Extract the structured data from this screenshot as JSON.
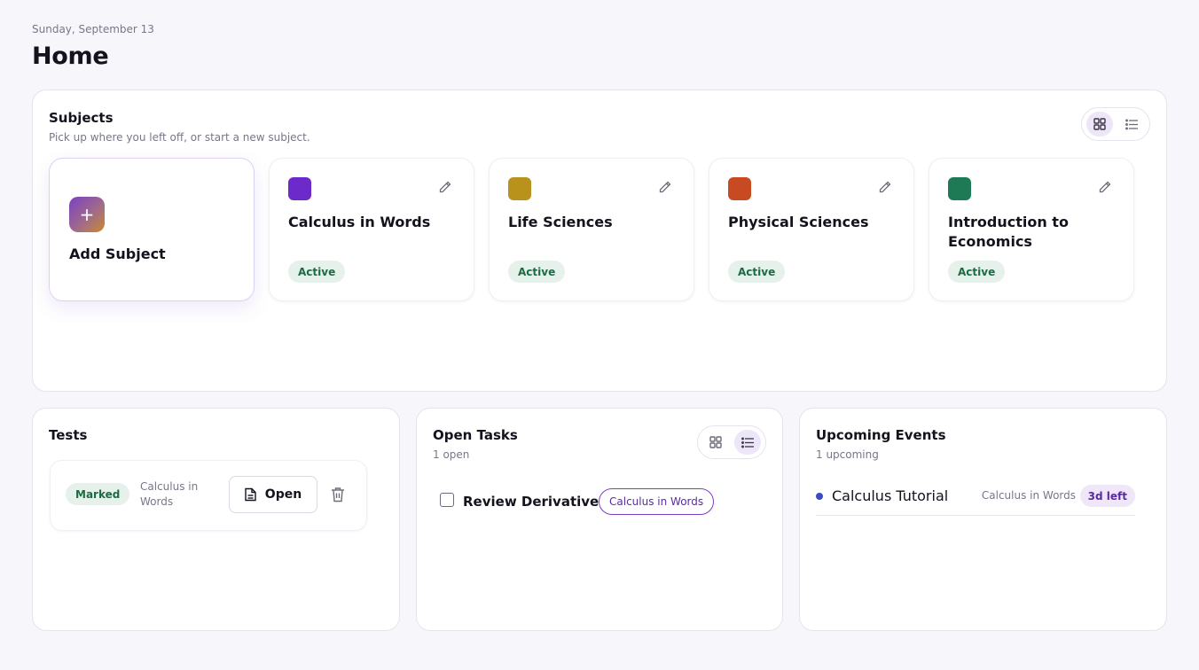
{
  "header": {
    "date": "Sunday, September 13",
    "title": "Home"
  },
  "subjects": {
    "title": "Subjects",
    "subtitle": "Pick up where you left off, or start a new subject.",
    "view": "grid",
    "add_label": "Add Subject",
    "items": [
      {
        "name": "Calculus in Words",
        "status": "Active",
        "color": "#6b2ac9"
      },
      {
        "name": "Life Sciences",
        "status": "Active",
        "color": "#b8921a"
      },
      {
        "name": "Physical Sciences",
        "status": "Active",
        "color": "#c84a22"
      },
      {
        "name": "Introduction to Economics",
        "status": "Active",
        "color": "#1e7a55"
      }
    ]
  },
  "tests": {
    "title": "Tests",
    "items": [
      {
        "status": "Marked",
        "subject": "Calculus in Words",
        "open_label": "Open"
      }
    ]
  },
  "tasks": {
    "title": "Open Tasks",
    "count": "1 open",
    "view": "list",
    "items": [
      {
        "name": "Review Derivatives",
        "subject": "Calculus in Words",
        "done": false
      }
    ]
  },
  "events": {
    "title": "Upcoming Events",
    "count": "1 upcoming",
    "items": [
      {
        "name": "Calculus Tutorial",
        "subject": "Calculus in Words",
        "time_left": "3d left"
      }
    ]
  },
  "colors": {
    "accent": "#7b3fc4",
    "active_badge_bg": "#e5f1ea",
    "active_badge_text": "#1d6b45",
    "event_dot": "#3b4bc4"
  }
}
